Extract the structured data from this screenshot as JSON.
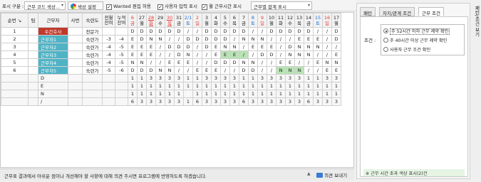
{
  "toolbar": {
    "display_label": "표시 구분 :",
    "display_select": "근무 코드 색상...",
    "color_setting": "색상 설정",
    "wanted_edit": "Wanted 편집 허용",
    "user_input": "사용자 입력 표시",
    "monthly_hours": "월 근무시간 표시",
    "sum_select": "근무별 합계 표시"
  },
  "grid": {
    "headers": {
      "seq": "순번 ↘",
      "team": "팀",
      "worker": "근무자",
      "emp_no": "사번",
      "skill": "숙련도",
      "prev_carry": "전월\n잔여",
      "cum_carry": "누적\n잔여"
    },
    "days": [
      {
        "num": "6",
        "dow": "금",
        "color": "red"
      },
      {
        "num": "27",
        "dow": "월",
        "color": ""
      },
      {
        "num": "28",
        "dow": "화",
        "color": "red",
        "underline": true
      },
      {
        "num": "29",
        "dow": "수",
        "color": ""
      },
      {
        "num": "30",
        "dow": "목",
        "color": "red",
        "underline": true
      },
      {
        "num": "31",
        "dow": "금",
        "color": ""
      },
      {
        "num": "2/1",
        "dow": "토",
        "color": "blue"
      },
      {
        "num": "2",
        "dow": "일",
        "color": "red"
      },
      {
        "num": "3",
        "dow": "월",
        "color": ""
      },
      {
        "num": "4",
        "dow": "화",
        "color": ""
      },
      {
        "num": "5",
        "dow": "수",
        "color": ""
      },
      {
        "num": "6",
        "dow": "목",
        "color": ""
      },
      {
        "num": "7",
        "dow": "금",
        "color": ""
      },
      {
        "num": "8",
        "dow": "토",
        "color": "blue"
      },
      {
        "num": "9",
        "dow": "일",
        "color": "red"
      },
      {
        "num": "10",
        "dow": "월",
        "color": ""
      },
      {
        "num": "11",
        "dow": "화",
        "color": ""
      },
      {
        "num": "12",
        "dow": "수",
        "color": ""
      },
      {
        "num": "13",
        "dow": "목",
        "color": ""
      },
      {
        "num": "14",
        "dow": "금",
        "color": ""
      },
      {
        "num": "15",
        "dow": "토",
        "color": "blue"
      },
      {
        "num": "16",
        "dow": "일",
        "color": "red"
      },
      {
        "num": "17",
        "dow": "월",
        "color": ""
      }
    ],
    "rows": [
      {
        "seq": "1",
        "name": "수간호사",
        "name_color": "red",
        "skill": "전문가",
        "prev": "",
        "cum": "",
        "cells": [
          "D",
          "D",
          "D",
          "D",
          "D",
          "D",
          "/",
          "/",
          "D",
          "D",
          "D",
          "D",
          "D",
          "/",
          "/",
          "D",
          "D",
          "D",
          "D",
          "D",
          "/",
          "/",
          "D"
        ]
      },
      {
        "seq": "2",
        "name": "근무자1",
        "name_color": "teal",
        "skill": "숙련가",
        "prev": "-3",
        "cum": "-4",
        "cells": [
          "E",
          "D",
          "N",
          "N",
          "/",
          "/",
          "D",
          "D",
          "D",
          "D",
          "D",
          "/",
          "N",
          "N",
          "N",
          "/",
          "/",
          "/",
          "E",
          "E",
          "E",
          "/",
          "D"
        ]
      },
      {
        "seq": "3",
        "name": "근무자2",
        "name_color": "teal",
        "skill": "숙련가",
        "prev": "-4",
        "cum": "-5",
        "cells": [
          "E",
          "E",
          "E",
          "/",
          "D",
          "D",
          "D",
          "/",
          "D",
          "E",
          "N",
          "N",
          "/",
          "E",
          "E",
          "E",
          "/",
          "D",
          "N",
          "N",
          "N",
          "/",
          "/"
        ]
      },
      {
        "seq": "4",
        "name": "근무자3",
        "name_color": "teal",
        "skill": "숙련가",
        "prev": "-4",
        "cum": "-5",
        "cells": [
          "E",
          "E",
          "E",
          "/",
          "/",
          "D",
          "N",
          "/",
          "/",
          "E",
          "E",
          "E",
          "/",
          "/",
          "D",
          "D",
          "/",
          "N",
          "N",
          "N",
          "/",
          "/",
          "E"
        ]
      },
      {
        "seq": "5",
        "name": "근무자4",
        "name_color": "teal",
        "skill": "숙련가",
        "prev": "-4",
        "cum": "-5",
        "cells": [
          "N",
          "N",
          "/",
          "/",
          "E",
          "E",
          "E",
          "/",
          "/",
          "D",
          "D",
          "D",
          "N",
          "N",
          "/",
          "/",
          "E",
          "E",
          "/",
          "/",
          "E",
          "N",
          "N"
        ]
      },
      {
        "seq": "6",
        "name": "근무자5",
        "name_color": "teal",
        "skill": "숙련가",
        "prev": "-5",
        "cum": "-6",
        "cells": [
          "D",
          "D",
          "D",
          "N",
          "N",
          "/",
          "/",
          "E",
          "E",
          "E",
          "/",
          "/",
          "D",
          "D",
          "/",
          "/",
          "N",
          "N",
          "N",
          "/",
          "/",
          "E",
          "E"
        ]
      }
    ],
    "summary": [
      {
        "code": "D",
        "cells": [
          "1",
          "1",
          "3",
          "3",
          "3",
          "3",
          "1",
          "1",
          "3",
          "3",
          "3",
          "3",
          "1",
          "1",
          "3",
          "3",
          "3",
          "3",
          "3",
          "1",
          "1",
          "3",
          "3"
        ]
      },
      {
        "code": "E",
        "cells": [
          "1",
          "1",
          "1",
          "1",
          "1",
          "1",
          "1",
          "1",
          "1",
          "1",
          "1",
          "1",
          "1",
          "1",
          "1",
          "1",
          "1",
          "1",
          "1",
          "1",
          "1",
          "1",
          "1"
        ]
      },
      {
        "code": "N",
        "cells": [
          "1",
          "1",
          "1",
          "1",
          "1",
          "1",
          "2",
          "1",
          "1",
          "1",
          "1",
          "1",
          "1",
          "1",
          "1",
          "1",
          "1",
          "1",
          "1",
          "1",
          "1",
          "1",
          "1"
        ]
      },
      {
        "code": "/",
        "cells": [
          "6",
          "3",
          "3",
          "3",
          "3",
          "3",
          "1",
          "6",
          "3",
          "3",
          "3",
          "3",
          "6",
          "3",
          "3",
          "3",
          "3",
          "3",
          "3",
          "6",
          "3",
          "3",
          "3"
        ]
      }
    ]
  },
  "footer": {
    "message": "근무표 결과에서 아쉬운 점이나 개선해야 할 사항에 대해 의견 주시면 프로그램에 반영하도록 하겠습니다.",
    "feedback": "의견 보내기"
  },
  "panel": {
    "tabs": [
      "패턴",
      "차지/관계 조건",
      "근무 조건"
    ],
    "condition_label": "조건 :",
    "options": [
      "주 52시간 이하 근무 제약 확인",
      "주 40시간 이상 근무 제약 확인",
      "사용자 근무 조건 확인"
    ],
    "legend": "※ 근무 시간 초과 색상 표시(2)건",
    "side_label": "패턴/조건 보기"
  },
  "colors": {
    "accent_red": "#c0392b",
    "teal": "#4fb3c5",
    "green": "#b8e3b4"
  }
}
